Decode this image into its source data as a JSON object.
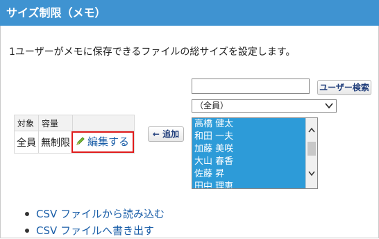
{
  "header": {
    "title": "サイズ制限（メモ）"
  },
  "description": "1ユーザーがメモに保存できるファイルの総サイズを設定します。",
  "table": {
    "headers": [
      "対象",
      "容量",
      ""
    ],
    "row": {
      "target": "全員",
      "capacity": "無制限",
      "edit_label": "編集する"
    }
  },
  "add_button": {
    "label": "← 追加"
  },
  "search": {
    "value": "",
    "button_label": "ユーザー検索"
  },
  "group_select": {
    "selected": "（全員）"
  },
  "users": [
    "高橋 健太",
    "和田 一夫",
    "加藤 美咲",
    "大山 春香",
    "佐藤 昇",
    "田中 理恵"
  ],
  "links": [
    "CSV ファイルから読み込む",
    "CSV ファイルへ書き出す"
  ],
  "colors": {
    "header_bg": "#3f93d1",
    "list_bg": "#2d9bd8",
    "highlight_border": "#e01b1b",
    "link": "#1a5ea8"
  },
  "icons": {
    "edit": "pencil-icon",
    "select": "chevron-down-icon"
  }
}
